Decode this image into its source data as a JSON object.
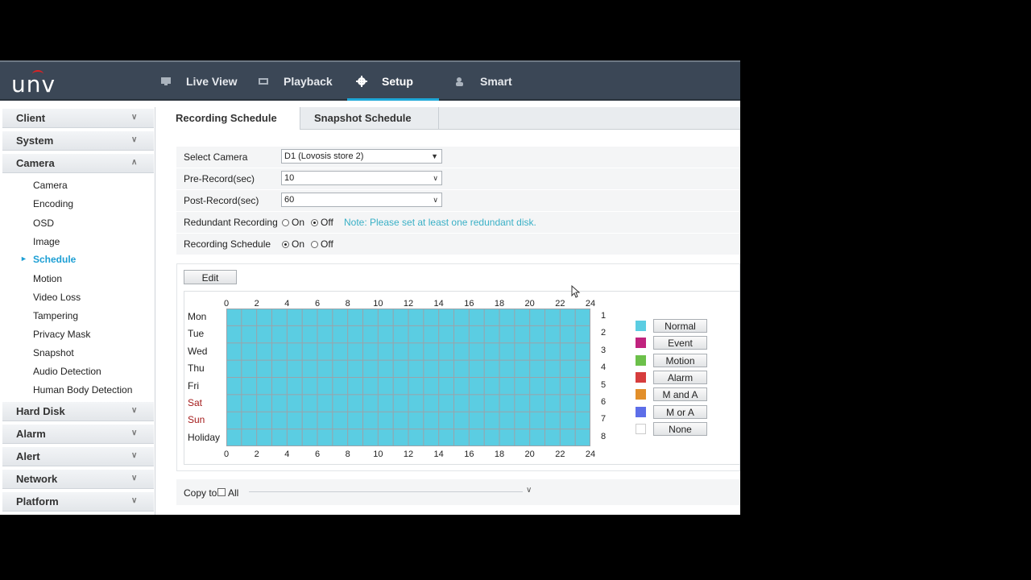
{
  "app": {
    "logo": "unv"
  },
  "nav": [
    {
      "label": "Live View",
      "icon": "monitor-icon"
    },
    {
      "label": "Playback",
      "icon": "film-icon"
    },
    {
      "label": "Setup",
      "icon": "gear-icon",
      "active": true
    },
    {
      "label": "Smart",
      "icon": "user-icon"
    }
  ],
  "sidebar": {
    "sections": [
      "Client",
      "System",
      "Camera",
      "Hard Disk",
      "Alarm",
      "Alert",
      "Network",
      "Platform"
    ],
    "camera_items": [
      "Camera",
      "Encoding",
      "OSD",
      "Image",
      "Schedule",
      "Motion",
      "Video Loss",
      "Tampering",
      "Privacy Mask",
      "Snapshot",
      "Audio Detection",
      "Human Body Detection"
    ],
    "active_item": "Schedule"
  },
  "tabs": {
    "recording": "Recording Schedule",
    "snapshot": "Snapshot Schedule"
  },
  "form": {
    "select_camera_label": "Select Camera",
    "select_camera_value": "D1 (Lovosis store 2)",
    "pre_record_label": "Pre-Record(sec)",
    "pre_record_value": "10",
    "post_record_label": "Post-Record(sec)",
    "post_record_value": "60",
    "redundant_label": "Redundant Recording",
    "on_label": "On",
    "off_label": "Off",
    "redundant_note": "Note: Please set at least one redundant disk.",
    "schedule_label": "Recording Schedule"
  },
  "schedule": {
    "edit_label": "Edit",
    "hours": [
      "0",
      "2",
      "4",
      "6",
      "8",
      "10",
      "12",
      "14",
      "16",
      "18",
      "20",
      "22",
      "24"
    ],
    "days": [
      "Mon",
      "Tue",
      "Wed",
      "Thu",
      "Fri",
      "Sat",
      "Sun",
      "Holiday"
    ],
    "row_numbers": [
      "1",
      "2",
      "3",
      "4",
      "5",
      "6",
      "7",
      "8"
    ],
    "fill_color": "#5bcde2",
    "grid_line_color": "#9aa3aa",
    "legend": [
      {
        "label": "Normal",
        "color": "#5bcde2"
      },
      {
        "label": "Event",
        "color": "#c0237e"
      },
      {
        "label": "Motion",
        "color": "#6cc04a"
      },
      {
        "label": "Alarm",
        "color": "#d63d3d"
      },
      {
        "label": "M and A",
        "color": "#e28f2a"
      },
      {
        "label": "M or A",
        "color": "#5d6ee8"
      },
      {
        "label": "None",
        "color": "#ffffff"
      }
    ]
  },
  "copy": {
    "label": "Copy to",
    "all_label": "All"
  }
}
